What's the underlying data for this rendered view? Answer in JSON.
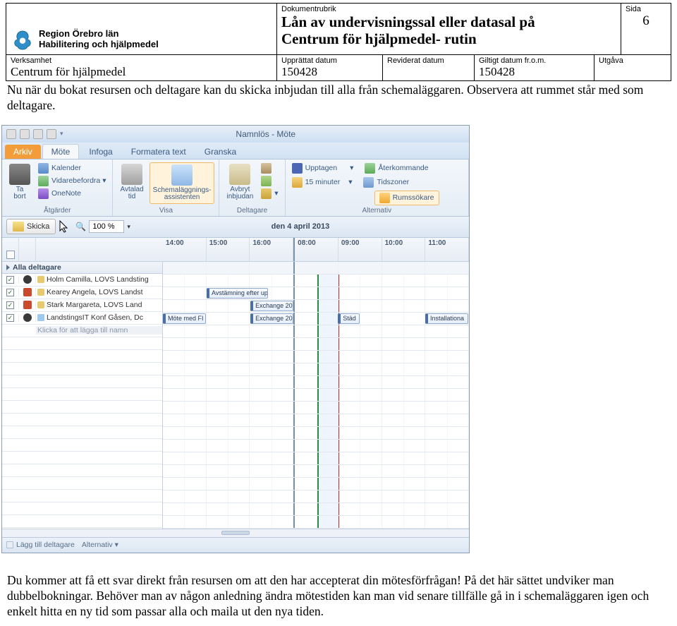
{
  "header": {
    "dokumentrubrik_label": "Dokumentrubrik",
    "title_line1": "Lån av undervisningssal eller datasal på",
    "title_line2": "Centrum för hjälpmedel- rutin",
    "sida_label": "Sida",
    "sida_value": "6",
    "logo_line1": "Region Örebro län",
    "logo_line2": "Habilitering och hjälpmedel"
  },
  "subheader": {
    "verksamhet_label": "Verksamhet",
    "verksamhet_value": "Centrum för hjälpmedel",
    "upprattat_label": "Upprättat datum",
    "upprattat_value": "150428",
    "reviderat_label": "Reviderat datum",
    "reviderat_value": "",
    "giltigt_label": "Giltigt datum fr.o.m.",
    "giltigt_value": "150428",
    "utgava_label": "Utgåva",
    "utgava_value": ""
  },
  "para1": "Nu när du bokat resursen och deltagare kan du skicka inbjudan till alla från schemaläggaren. Observera att rummet står med som deltagare.",
  "para2": "Du kommer att få ett svar direkt från resursen om att den har accepterat din mötesförfrågan! På det här sättet undviker man dubbelbokningar. Behöver man av någon anledning ändra mötestiden kan man vid senare tillfälle gå in i schemaläggaren igen och enkelt hitta en ny tid som passar alla och maila ut den nya tiden.",
  "outlook": {
    "window_title": "Namnlös - Möte",
    "tabs": {
      "arkiv": "Arkiv",
      "mote": "Möte",
      "infoga": "Infoga",
      "formatera": "Formatera text",
      "granska": "Granska"
    },
    "ribbon": {
      "tabort": "Ta\nbort",
      "kalender": "Kalender",
      "vidare": "Vidarebefordra ▾",
      "onenote": "OneNote",
      "atgarder": "Åtgärder",
      "avtalad": "Avtalad\ntid",
      "schemalagg": "Schemaläggnings-\nassistenten",
      "visa": "Visa",
      "avbryt": "Avbryt\ninbjudan",
      "adress": "",
      "kontroll": "",
      "svars": "▾",
      "deltagare": "Deltagare",
      "upptagen": "Upptagen",
      "minuter": "15 minuter",
      "aterkommande": "Återkommande",
      "tidszoner": "Tidszoner",
      "rumssokare": "Rumssökare",
      "alternativ": "Alternativ"
    },
    "toolbar2": {
      "skicka": "Skicka",
      "zoom": "100 %",
      "date": "den 4 april 2013"
    },
    "times": [
      "14:00",
      "15:00",
      "16:00",
      "08:00",
      "09:00",
      "10:00",
      "11:00"
    ],
    "section_header": "Alla deltagare",
    "attendees": [
      {
        "name": "Holm Camilla, LOVS Landsting",
        "type": "org"
      },
      {
        "name": "Kearey Angela, LOVS Landst",
        "type": "req"
      },
      {
        "name": "Stark Margareta, LOVS Land",
        "type": "req"
      },
      {
        "name": "LandstingsIT Konf Gåsen, Dc",
        "type": "room"
      }
    ],
    "add_placeholder": "Klicka för att lägga till namn",
    "appts": {
      "a1": "Avstämning efter up",
      "a2": "Möte med FI",
      "a3": "Exchange 20",
      "a4": "Exchange 20",
      "a5": "Städ",
      "a6": "Installationa"
    },
    "footer": {
      "lagg": "Lägg till deltagare",
      "alt": "Alternativ ▾"
    }
  }
}
